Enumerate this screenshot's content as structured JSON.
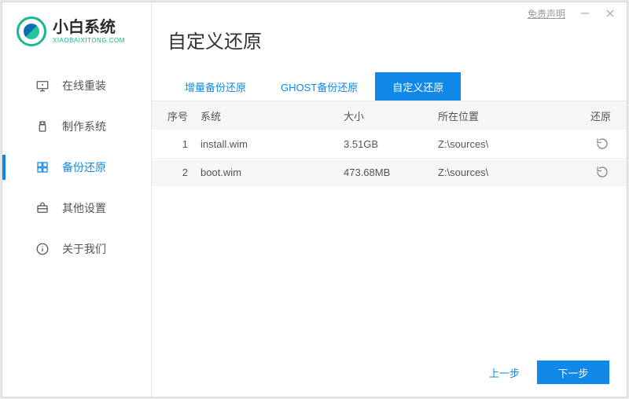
{
  "window": {
    "disclaimer": "免责声明"
  },
  "logo": {
    "title": "小白系统",
    "subtitle": "XIAOBAIXITONG.COM"
  },
  "nav": [
    {
      "label": "在线重装",
      "icon": "online-reinstall",
      "active": false
    },
    {
      "label": "制作系统",
      "icon": "make-system",
      "active": false
    },
    {
      "label": "备份还原",
      "icon": "backup-restore",
      "active": true
    },
    {
      "label": "其他设置",
      "icon": "other-settings",
      "active": false
    },
    {
      "label": "关于我们",
      "icon": "about",
      "active": false
    }
  ],
  "page": {
    "title": "自定义还原"
  },
  "tabs": [
    {
      "label": "增量备份还原",
      "active": false
    },
    {
      "label": "GHOST备份还原",
      "active": false
    },
    {
      "label": "自定义还原",
      "active": true
    }
  ],
  "table": {
    "headers": {
      "idx": "序号",
      "system": "系统",
      "size": "大小",
      "location": "所在位置",
      "action": "还原"
    },
    "rows": [
      {
        "idx": "1",
        "system": "install.wim",
        "size": "3.51GB",
        "location": "Z:\\sources\\"
      },
      {
        "idx": "2",
        "system": "boot.wim",
        "size": "473.68MB",
        "location": "Z:\\sources\\"
      }
    ]
  },
  "footer": {
    "prev": "上一步",
    "next": "下一步"
  }
}
